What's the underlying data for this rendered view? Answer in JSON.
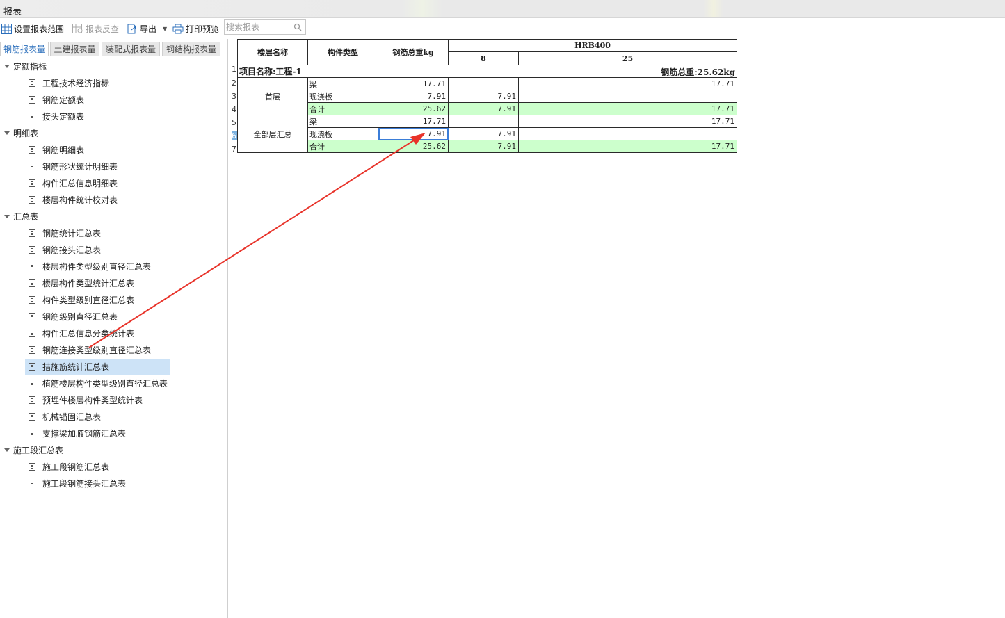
{
  "window": {
    "title": "报表"
  },
  "toolbar": {
    "set_range": "设置报表范围",
    "reverse_check": "报表反查",
    "export": "导出",
    "print_preview": "打印预览",
    "search_placeholder": "搜索报表"
  },
  "tabs": [
    "钢筋报表量",
    "土建报表量",
    "装配式报表量",
    "钢结构报表量"
  ],
  "tree": {
    "groups": [
      {
        "label": "定额指标",
        "items": [
          "工程技术经济指标",
          "钢筋定额表",
          "接头定额表"
        ]
      },
      {
        "label": "明细表",
        "items": [
          "钢筋明细表",
          "钢筋形状统计明细表",
          "构件汇总信息明细表",
          "楼层构件统计校对表"
        ]
      },
      {
        "label": "汇总表",
        "items": [
          "钢筋统计汇总表",
          "钢筋接头汇总表",
          "楼层构件类型级别直径汇总表",
          "楼层构件类型统计汇总表",
          "构件类型级别直径汇总表",
          "钢筋级别直径汇总表",
          "构件汇总信息分类统计表",
          "钢筋连接类型级别直径汇总表",
          "措施筋统计汇总表",
          "植筋楼层构件类型级别直径汇总表",
          "预埋件楼层构件类型统计表",
          "机械锚固汇总表",
          "支撑梁加腋钢筋汇总表"
        ]
      },
      {
        "label": "施工段汇总表",
        "items": [
          "施工段钢筋汇总表",
          "施工段钢筋接头汇总表"
        ]
      }
    ],
    "selected": "措施筋统计汇总表"
  },
  "report": {
    "headers": {
      "floor": "楼层名称",
      "type": "构件类型",
      "total": "钢筋总重kg",
      "grade": "HRB400",
      "d8": "8",
      "d25": "25"
    },
    "project_label": "项目名称:工程-1",
    "total_label": "钢筋总重:25.62kg",
    "row_numbers": [
      "1",
      "2",
      "3",
      "4",
      "5",
      "6",
      "7"
    ],
    "groups": [
      {
        "floor": "首层",
        "rows": [
          {
            "type": "梁",
            "total": "17.71",
            "d8": "",
            "d25": "17.71"
          },
          {
            "type": "现浇板",
            "total": "7.91",
            "d8": "7.91",
            "d25": ""
          },
          {
            "type": "合计",
            "total": "25.62",
            "d8": "7.91",
            "d25": "17.71"
          }
        ]
      },
      {
        "floor": "全部层汇总",
        "rows": [
          {
            "type": "梁",
            "total": "17.71",
            "d8": "",
            "d25": "17.71"
          },
          {
            "type": "现浇板",
            "total": "7.91",
            "d8": "7.91",
            "d25": ""
          },
          {
            "type": "合计",
            "total": "25.62",
            "d8": "7.91",
            "d25": "17.71"
          }
        ]
      }
    ]
  },
  "colors": {
    "subtotal_bg": "#ccffcc",
    "selection": "#cde3f7",
    "arrow": "#e8332a",
    "active_tab": "#2a6ebb"
  }
}
